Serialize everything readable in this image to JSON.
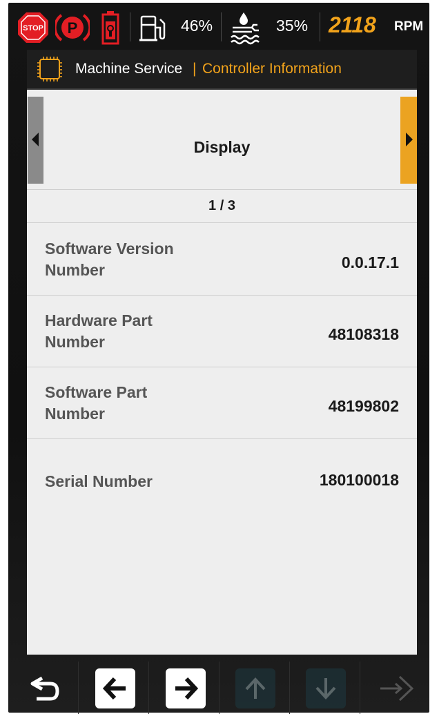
{
  "status_bar": {
    "icons": [
      "stop-icon",
      "parking-brake-icon",
      "battery-warning-icon",
      "fuel-icon",
      "def-fluid-icon"
    ],
    "fuel_level": "46%",
    "def_level": "35%",
    "rpm_value": "2118",
    "rpm_unit": "RPM",
    "stop_label": "STOP",
    "park_label": "P"
  },
  "header": {
    "icon": "chip-icon",
    "title": "Machine Service",
    "separator": "|",
    "subtitle": "Controller Information"
  },
  "nav": {
    "title": "Display",
    "page": "1 / 3"
  },
  "info_rows": [
    {
      "label": "Software Version Number",
      "value": "0.0.17.1"
    },
    {
      "label": "Hardware Part Number",
      "value": "48108318"
    },
    {
      "label": "Software Part Number",
      "value": "48199802"
    },
    {
      "label": "Serial Number",
      "value": "180100018"
    }
  ],
  "toolbar": {
    "buttons": [
      {
        "icon": "back-icon",
        "enabled": true
      },
      {
        "icon": "arrow-left-icon",
        "enabled": true
      },
      {
        "icon": "arrow-right-icon",
        "enabled": true
      },
      {
        "icon": "arrow-up-icon",
        "enabled": false
      },
      {
        "icon": "arrow-down-icon",
        "enabled": false
      },
      {
        "icon": "enter-icon",
        "enabled": false
      }
    ]
  },
  "colors": {
    "accent": "#f2a31b",
    "alarm_red": "#e31e24",
    "panel_bg": "#eeeeee",
    "header_bg": "#1e1e1e"
  }
}
